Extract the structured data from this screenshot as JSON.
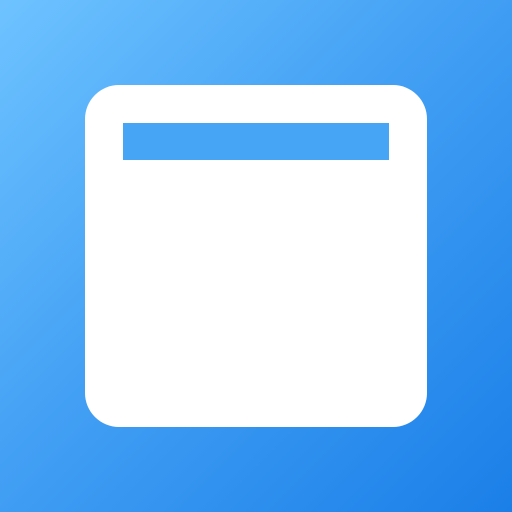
{
  "icon": {
    "name": "window-icon",
    "background_gradient": [
      "#6ec3ff",
      "#43a0f4",
      "#1a7fe8"
    ],
    "glyph_color": "#ffffff",
    "bar_color": "#47a5f5"
  }
}
